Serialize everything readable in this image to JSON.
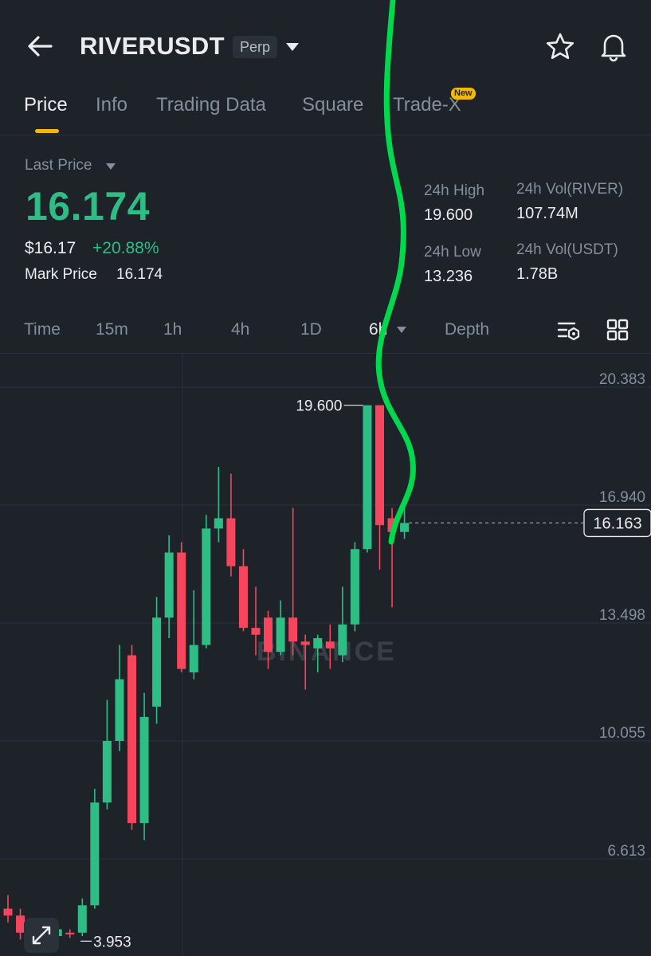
{
  "header": {
    "pair": "RIVERUSDT",
    "contract_type": "Perp",
    "icons": {
      "back": "back-arrow-icon",
      "dropdown": "caret-down-icon",
      "favorite": "star-icon",
      "alerts": "bell-icon"
    }
  },
  "tabs": [
    {
      "label": "Price",
      "active": true
    },
    {
      "label": "Info"
    },
    {
      "label": "Trading Data"
    },
    {
      "label": "Square"
    },
    {
      "label": "Trade-X",
      "badge": "New"
    }
  ],
  "summary": {
    "last_price_label": "Last Price",
    "last_price": "16.174",
    "usd_price": "$16.17",
    "change_pct": "+20.88%",
    "mark_price_label": "Mark Price",
    "mark_price": "16.174",
    "stats": {
      "high_label": "24h High",
      "high": "19.600",
      "low_label": "24h Low",
      "low": "13.236",
      "vol_base_label": "24h Vol(RIVER)",
      "vol_base": "107.74M",
      "vol_quote_label": "24h Vol(USDT)",
      "vol_quote": "1.78B"
    }
  },
  "timeframes": [
    {
      "label": "Time"
    },
    {
      "label": "15m"
    },
    {
      "label": "1h"
    },
    {
      "label": "4h"
    },
    {
      "label": "1D"
    },
    {
      "label": "6h",
      "active": true
    },
    {
      "label": "Depth"
    }
  ],
  "colors": {
    "up": "#2ebd85",
    "down": "#f6465d",
    "accent": "#f0b90b",
    "background": "#1e2329",
    "annotation": "#00d84e"
  },
  "chart_data": {
    "type": "candlestick",
    "watermark": "BINANCE",
    "y_ticks": [
      "20.383",
      "16.940",
      "13.498",
      "10.055",
      "6.613"
    ],
    "ylim": [
      2.6,
      20.9
    ],
    "current_price": "16.163",
    "high_label": "19.600",
    "low_label": "3.953",
    "candles": [
      {
        "open": 4.9,
        "high": 5.3,
        "low": 4.5,
        "close": 4.7
      },
      {
        "open": 4.7,
        "high": 4.9,
        "low": 4.0,
        "close": 4.2
      },
      {
        "open": 4.2,
        "high": 4.6,
        "low": 3.953,
        "close": 4.35
      },
      {
        "open": 4.35,
        "high": 4.55,
        "low": 4.0,
        "close": 4.1
      },
      {
        "open": 4.1,
        "high": 4.4,
        "low": 3.95,
        "close": 4.3
      },
      {
        "open": 4.2,
        "high": 4.3,
        "low": 4.05,
        "close": 4.15
      },
      {
        "open": 4.2,
        "high": 5.2,
        "low": 4.1,
        "close": 5.0
      },
      {
        "open": 5.0,
        "high": 8.4,
        "low": 4.9,
        "close": 8.0
      },
      {
        "open": 8.0,
        "high": 11.0,
        "low": 7.8,
        "close": 9.8
      },
      {
        "open": 9.8,
        "high": 12.6,
        "low": 9.5,
        "close": 11.6
      },
      {
        "open": 12.3,
        "high": 12.6,
        "low": 7.2,
        "close": 7.4
      },
      {
        "open": 7.4,
        "high": 11.2,
        "low": 6.9,
        "close": 10.5
      },
      {
        "open": 10.8,
        "high": 14.0,
        "low": 10.3,
        "close": 13.4
      },
      {
        "open": 13.4,
        "high": 15.8,
        "low": 12.8,
        "close": 15.3
      },
      {
        "open": 15.3,
        "high": 15.6,
        "low": 11.8,
        "close": 11.9
      },
      {
        "open": 11.8,
        "high": 14.2,
        "low": 11.6,
        "close": 12.6
      },
      {
        "open": 12.6,
        "high": 16.4,
        "low": 12.5,
        "close": 16.0
      },
      {
        "open": 16.0,
        "high": 17.8,
        "low": 15.6,
        "close": 16.3
      },
      {
        "open": 16.3,
        "high": 17.6,
        "low": 14.6,
        "close": 14.9
      },
      {
        "open": 14.9,
        "high": 15.4,
        "low": 13.0,
        "close": 13.1
      },
      {
        "open": 13.1,
        "high": 14.3,
        "low": 12.3,
        "close": 12.9
      },
      {
        "open": 13.4,
        "high": 13.6,
        "low": 11.9,
        "close": 12.4
      },
      {
        "open": 12.4,
        "high": 13.9,
        "low": 12.3,
        "close": 13.4
      },
      {
        "open": 13.4,
        "high": 16.6,
        "low": 12.3,
        "close": 12.7
      },
      {
        "open": 12.7,
        "high": 12.9,
        "low": 11.3,
        "close": 12.6
      },
      {
        "open": 12.5,
        "high": 12.9,
        "low": 11.8,
        "close": 12.8
      },
      {
        "open": 12.7,
        "high": 13.2,
        "low": 11.9,
        "close": 12.5
      },
      {
        "open": 12.3,
        "high": 14.3,
        "low": 12.1,
        "close": 13.2
      },
      {
        "open": 13.2,
        "high": 15.6,
        "low": 13.0,
        "close": 15.4
      },
      {
        "open": 15.4,
        "high": 19.6,
        "low": 15.3,
        "close": 19.6
      },
      {
        "open": 19.6,
        "high": 19.6,
        "low": 14.8,
        "close": 16.1
      },
      {
        "open": 16.3,
        "high": 16.6,
        "low": 13.7,
        "close": 15.9
      },
      {
        "open": 15.9,
        "high": 16.8,
        "low": 15.7,
        "close": 16.163
      }
    ]
  }
}
